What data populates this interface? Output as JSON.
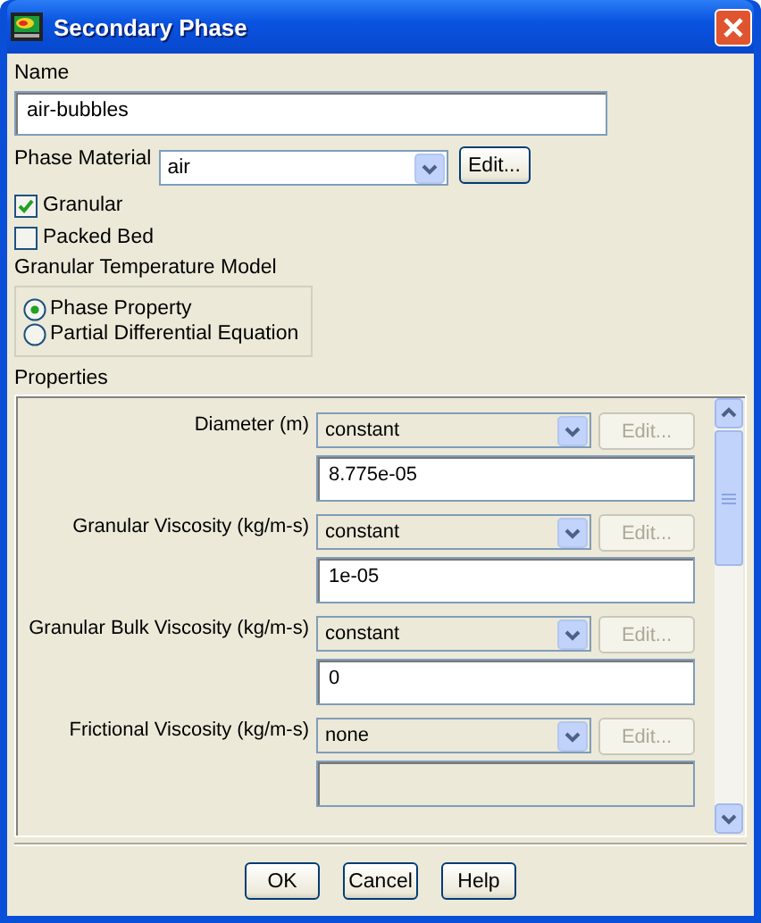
{
  "window": {
    "title": "Secondary Phase"
  },
  "name": {
    "label": "Name",
    "value": "air-bubbles"
  },
  "phase_material": {
    "label": "Phase Material",
    "value": "air",
    "button": "Edit..."
  },
  "options": [
    {
      "label": "Granular",
      "checked": true
    },
    {
      "label": "Packed Bed",
      "checked": false
    }
  ],
  "granular_temperature_model": {
    "label": "Granular Temperature Model",
    "options": [
      {
        "label": "Phase Property",
        "selected": true
      },
      {
        "label": "Partial Differential Equation",
        "selected": false
      }
    ]
  },
  "properties": {
    "label": "Properties",
    "rows": [
      {
        "label": "Diameter (m)",
        "method": "constant",
        "button": "Edit...",
        "button_disabled": true,
        "value": "8.775e-05",
        "field_disabled": false
      },
      {
        "label": "Granular Viscosity (kg/m-s)",
        "method": "constant",
        "button": "Edit...",
        "button_disabled": true,
        "value": "1e-05",
        "field_disabled": false
      },
      {
        "label": "Granular Bulk Viscosity (kg/m-s)",
        "method": "constant",
        "button": "Edit...",
        "button_disabled": true,
        "value": "0",
        "field_disabled": false
      },
      {
        "label": "Frictional Viscosity (kg/m-s)",
        "method": "none",
        "button": "Edit...",
        "button_disabled": true,
        "field_disabled": true
      }
    ]
  },
  "buttons": [
    "OK",
    "Cancel",
    "Help"
  ]
}
